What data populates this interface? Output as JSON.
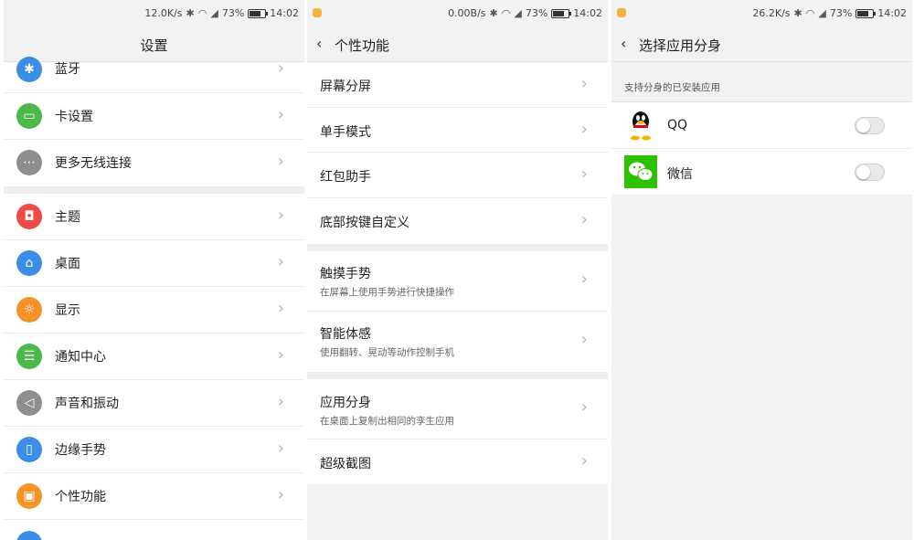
{
  "colors": {
    "accent_blue": "#3a8ee6",
    "green": "#4cb848",
    "red": "#ee4b45",
    "orange": "#f59327",
    "gray": "#8e8e8e",
    "wechat_green": "#2dc100"
  },
  "panels": [
    {
      "status": {
        "speed": "12.0K/s",
        "battery": "73%",
        "time": "14:02"
      },
      "title": "设置",
      "items": [
        {
          "label": "蓝牙",
          "icon": "bluetooth-icon"
        },
        {
          "label": "卡设置",
          "icon": "sim-card-icon"
        },
        {
          "label": "更多无线连接",
          "icon": "more-icon"
        },
        {
          "label": "主题",
          "icon": "theme-shirt-icon"
        },
        {
          "label": "桌面",
          "icon": "home-icon"
        },
        {
          "label": "显示",
          "icon": "brightness-icon"
        },
        {
          "label": "通知中心",
          "icon": "notification-icon"
        },
        {
          "label": "声音和振动",
          "icon": "speaker-icon"
        },
        {
          "label": "边缘手势",
          "icon": "edge-gesture-icon"
        },
        {
          "label": "个性功能",
          "icon": "personal-feature-icon"
        }
      ]
    },
    {
      "status": {
        "speed": "0.00B/s",
        "battery": "73%",
        "time": "14:02"
      },
      "title": "个性功能",
      "items": [
        {
          "label": "屏幕分屏",
          "sub": ""
        },
        {
          "label": "单手模式",
          "sub": ""
        },
        {
          "label": "红包助手",
          "sub": ""
        },
        {
          "label": "底部按键自定义",
          "sub": ""
        },
        {
          "label": "触摸手势",
          "sub": "在屏幕上使用手势进行快捷操作"
        },
        {
          "label": "智能体感",
          "sub": "使用翻转、晃动等动作控制手机"
        },
        {
          "label": "应用分身",
          "sub": "在桌面上复制出相同的孪生应用"
        },
        {
          "label": "超级截图",
          "sub": ""
        }
      ]
    },
    {
      "status": {
        "speed": "26.2K/s",
        "battery": "73%",
        "time": "14:02"
      },
      "title": "选择应用分身",
      "caption": "支持分身的已安装应用",
      "apps": [
        {
          "label": "QQ",
          "enabled": false
        },
        {
          "label": "微信",
          "enabled": false
        }
      ]
    }
  ]
}
